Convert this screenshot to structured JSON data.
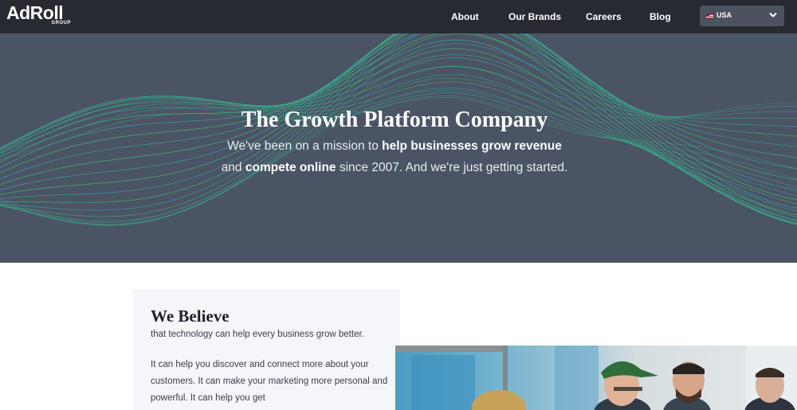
{
  "nav": {
    "logo_main": "AdRoll",
    "logo_sub": "GROUP",
    "links": [
      "About",
      "Our Brands",
      "Careers",
      "Blog"
    ],
    "region_label": "USA",
    "region_icon": "us-flag-icon"
  },
  "hero": {
    "title": "The Growth Platform Company",
    "subtitle_parts": [
      "We've been on a mission to ",
      "help businesses grow revenue",
      " and ",
      "compete online",
      " since 2007. And we're just getting started."
    ]
  },
  "believe": {
    "heading": "We Believe",
    "tagline": "that technology can help every business grow better.",
    "body": "It can help you discover and connect more about your customers. It can make your marketing more personal and powerful. It can help you get"
  },
  "colors": {
    "nav_bg": "#272b31",
    "hero_bg": "#4b5465",
    "wave_green": "#3ecf7a",
    "wave_teal": "#2fb7b0",
    "card_bg": "#f5f6f9"
  }
}
